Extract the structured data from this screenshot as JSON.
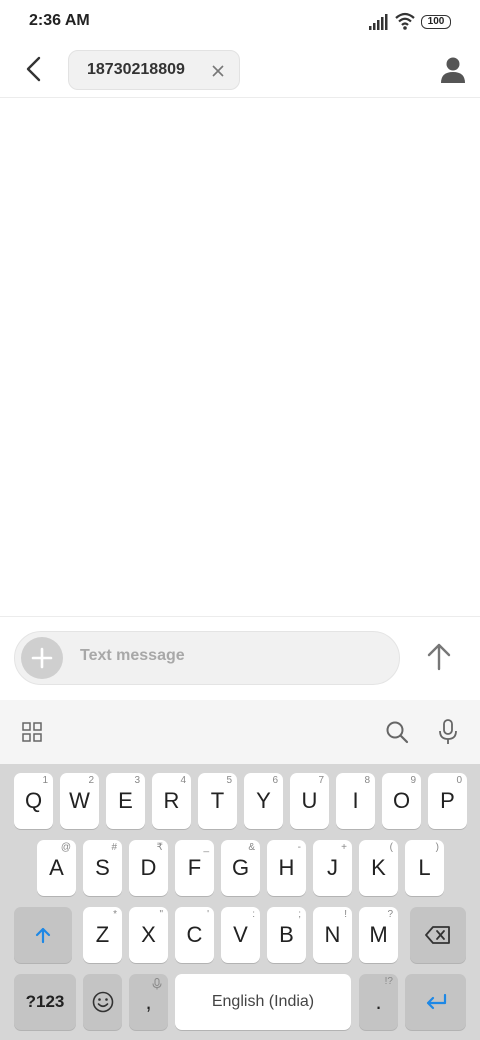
{
  "status": {
    "time": "2:36 AM",
    "battery": "100"
  },
  "header": {
    "recipient": "18730218809"
  },
  "compose": {
    "placeholder": "Text message"
  },
  "keyboard": {
    "row1": [
      {
        "key": "Q",
        "hint": "1"
      },
      {
        "key": "W",
        "hint": "2"
      },
      {
        "key": "E",
        "hint": "3"
      },
      {
        "key": "R",
        "hint": "4"
      },
      {
        "key": "T",
        "hint": "5"
      },
      {
        "key": "Y",
        "hint": "6"
      },
      {
        "key": "U",
        "hint": "7"
      },
      {
        "key": "I",
        "hint": "8"
      },
      {
        "key": "O",
        "hint": "9"
      },
      {
        "key": "P",
        "hint": "0"
      }
    ],
    "row2": [
      {
        "key": "A",
        "hint": "@"
      },
      {
        "key": "S",
        "hint": "#"
      },
      {
        "key": "D",
        "hint": "₹"
      },
      {
        "key": "F",
        "hint": "_"
      },
      {
        "key": "G",
        "hint": "&"
      },
      {
        "key": "H",
        "hint": "-"
      },
      {
        "key": "J",
        "hint": "+"
      },
      {
        "key": "K",
        "hint": "("
      },
      {
        "key": "L",
        "hint": ")"
      }
    ],
    "row3": [
      {
        "key": "Z",
        "hint": "*"
      },
      {
        "key": "X",
        "hint": "\""
      },
      {
        "key": "C",
        "hint": "'"
      },
      {
        "key": "V",
        "hint": ":"
      },
      {
        "key": "B",
        "hint": ";"
      },
      {
        "key": "N",
        "hint": "!"
      },
      {
        "key": "M",
        "hint": "?"
      }
    ],
    "symbols_key": "?123",
    "comma_key": ",",
    "space_label": "English (India)",
    "period_key": ".",
    "period_hint": "!?"
  }
}
